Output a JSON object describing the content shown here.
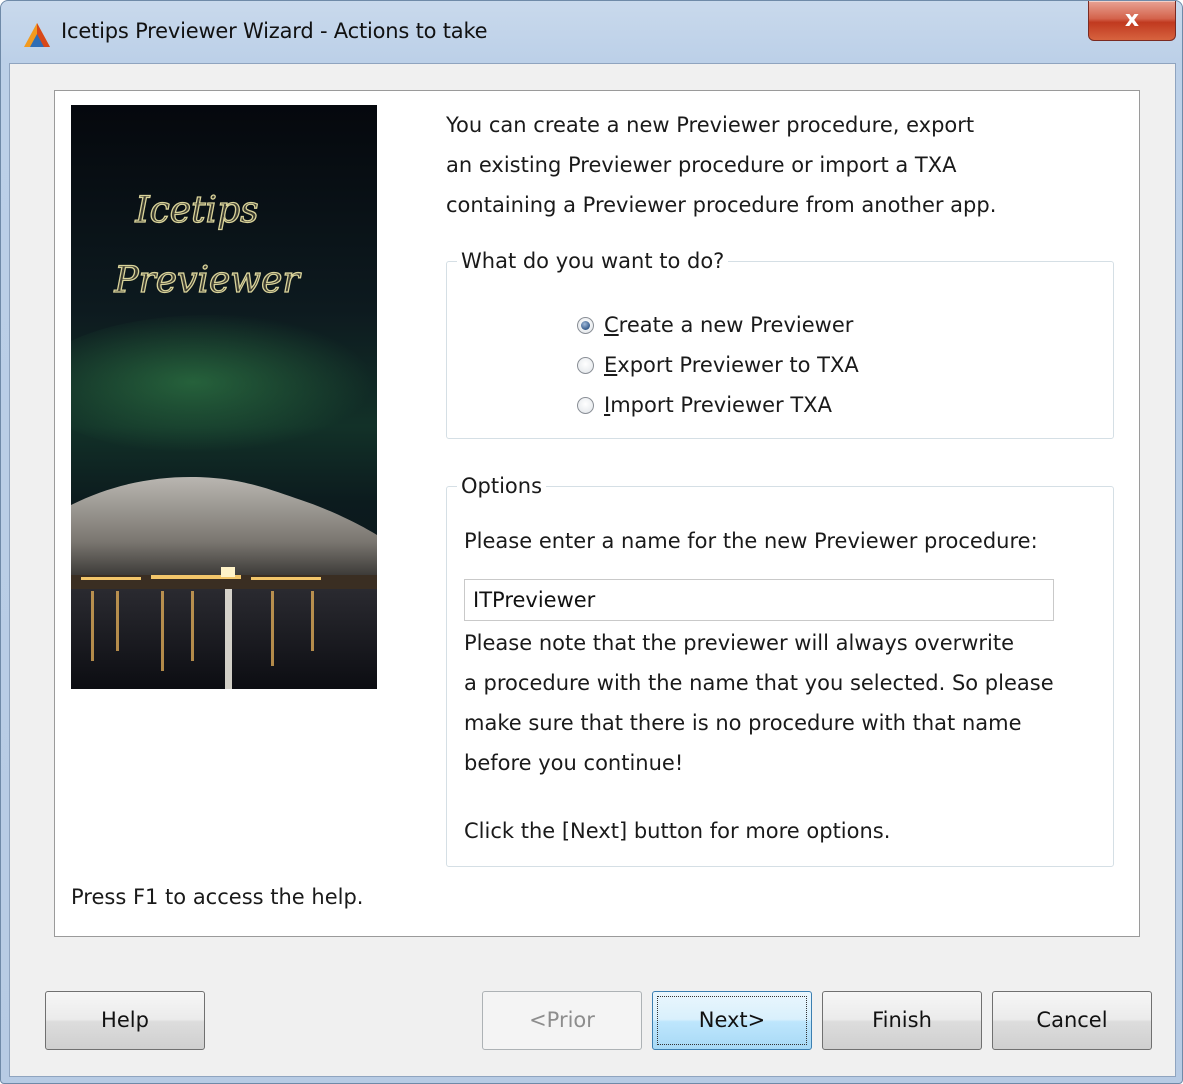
{
  "window": {
    "title": "Icetips Previewer Wizard - Actions to take",
    "close_label": "x"
  },
  "side_image": {
    "line1": "Icetips",
    "line2": "Previewer"
  },
  "intro": {
    "line1": "You can create a new Previewer procedure, export",
    "line2": "an existing Previewer procedure or import a TXA",
    "line3": "containing a Previewer procedure from another app."
  },
  "what_group": {
    "title": "What do you want to do?",
    "options": [
      {
        "accel": "C",
        "rest": "reate a new Previewer",
        "checked": true
      },
      {
        "accel": "E",
        "rest": "xport Previewer to TXA",
        "checked": false
      },
      {
        "accel": "I",
        "rest": "mport Previewer TXA",
        "checked": false
      }
    ]
  },
  "options_group": {
    "title": "Options",
    "prompt": "Please enter a name for the new Previewer procedure:",
    "name_value": "ITPreviewer",
    "note_line1": "Please note that the previewer will always overwrite",
    "note_line2": "a procedure with the name that you selected.  So please",
    "note_line3": "make sure that there is no procedure with that name",
    "note_line4": "before you continue!",
    "next_hint": "Click the [Next] button for more options."
  },
  "help_hint": "Press F1 to access the help.",
  "buttons": {
    "help": "Help",
    "prior": "<Prior",
    "next": "Next>",
    "finish": "Finish",
    "cancel": "Cancel"
  }
}
